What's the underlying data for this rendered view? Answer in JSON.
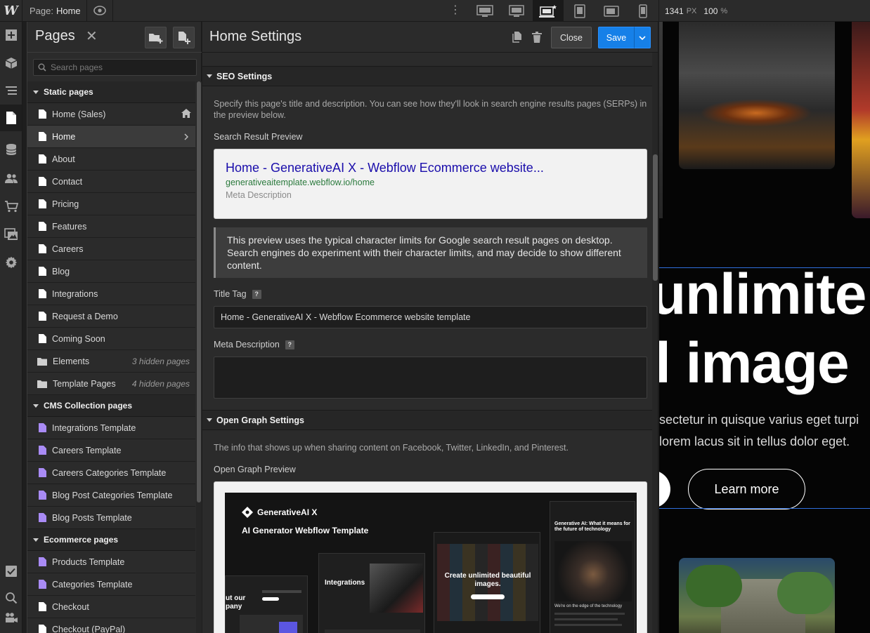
{
  "topbar": {
    "logo": "W",
    "page_label": "Page:",
    "page_value": "Home",
    "dots": "⋮",
    "width_value": "1341",
    "width_unit": "PX",
    "zoom_value": "100",
    "zoom_unit": "%"
  },
  "pages_panel": {
    "title": "Pages",
    "close": "✕",
    "search_placeholder": "Search pages",
    "groups": [
      {
        "label": "Static pages",
        "items": [
          {
            "label": "Home (Sales)",
            "kind": "static",
            "home": true
          },
          {
            "label": "Home",
            "kind": "static",
            "selected": true
          },
          {
            "label": "About",
            "kind": "static"
          },
          {
            "label": "Contact",
            "kind": "static"
          },
          {
            "label": "Pricing",
            "kind": "static"
          },
          {
            "label": "Features",
            "kind": "static"
          },
          {
            "label": "Careers",
            "kind": "static"
          },
          {
            "label": "Blog",
            "kind": "static"
          },
          {
            "label": "Integrations",
            "kind": "static"
          },
          {
            "label": "Request a Demo",
            "kind": "static"
          },
          {
            "label": "Coming Soon",
            "kind": "static"
          },
          {
            "label": "Elements",
            "kind": "folder",
            "note": "3 hidden pages"
          },
          {
            "label": "Template Pages",
            "kind": "folder",
            "note": "4 hidden pages"
          }
        ]
      },
      {
        "label": "CMS Collection pages",
        "items": [
          {
            "label": "Integrations Template",
            "kind": "cms"
          },
          {
            "label": "Careers Template",
            "kind": "cms"
          },
          {
            "label": "Careers Categories Template",
            "kind": "cms"
          },
          {
            "label": "Blog Post Categories Template",
            "kind": "cms"
          },
          {
            "label": "Blog Posts Template",
            "kind": "cms"
          }
        ]
      },
      {
        "label": "Ecommerce pages",
        "items": [
          {
            "label": "Products Template",
            "kind": "cms"
          },
          {
            "label": "Categories Template",
            "kind": "cms"
          },
          {
            "label": "Checkout",
            "kind": "static"
          },
          {
            "label": "Checkout (PayPal)",
            "kind": "static"
          }
        ]
      }
    ]
  },
  "settings": {
    "title": "Home Settings",
    "close_label": "Close",
    "save_label": "Save",
    "seo": {
      "header": "SEO Settings",
      "intro": "Specify this page's title and description. You can see how they'll look in search engine results pages (SERPs) in the preview below.",
      "preview_label": "Search Result Preview",
      "preview_title": "Home - GenerativeAI X - Webflow Ecommerce website...",
      "preview_url": "generativeaitemplate.webflow.io/home",
      "preview_desc": "Meta Description",
      "note": "This preview uses the typical character limits for Google search result pages on desktop. Search engines do experiment with their character limits, and may decide to show different content.",
      "title_tag_label": "Title Tag",
      "title_tag_value": "Home - GenerativeAI X - Webflow Ecommerce website template",
      "meta_label": "Meta Description",
      "meta_value": "",
      "help": "?"
    },
    "og": {
      "header": "Open Graph Settings",
      "intro": "The info that shows up when sharing content on Facebook, Twitter, LinkedIn, and Pinterest.",
      "preview_label": "Open Graph Preview",
      "image_brand": "GenerativeAI X",
      "image_headline": "AI Generator Webflow Template",
      "image_card_integrations": "Integrations",
      "image_card_create": "Create unlimited beautiful images.",
      "image_card_partial": "ut our pany",
      "image_card_blog": "Generative AI: What it means for the future of technology",
      "image_card_edge": "We're on the edge of the technology"
    }
  },
  "canvas": {
    "headline_1": "unlimite",
    "headline_2": "l image",
    "para_1": "sectetur in quisque varius eget turpi",
    "para_2": "lorem lacus sit in tellus dolor eget.",
    "cta": "Learn more"
  },
  "colors": {
    "accent": "#1680e8",
    "serp_link": "#1a0dab",
    "serp_url": "#2b7a3d",
    "cms_icon": "#a98bf5"
  }
}
